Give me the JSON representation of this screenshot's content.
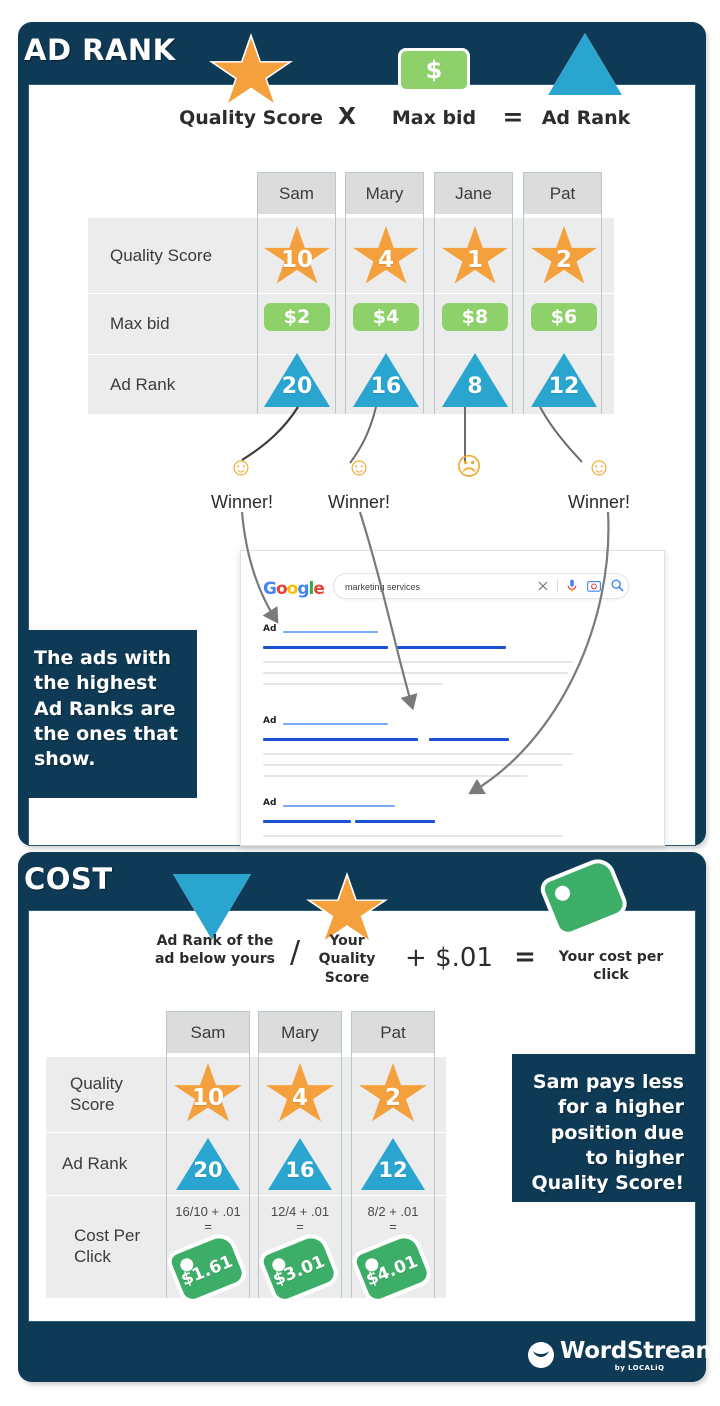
{
  "sections": {
    "ad_rank": {
      "title": "AD RANK",
      "formula": {
        "terms": [
          "Quality Score",
          "Max bid",
          "Ad Rank"
        ],
        "operators": [
          "X",
          "="
        ],
        "icons": [
          "star-icon",
          "money-chip-icon",
          "triangle-up-icon"
        ],
        "money_symbol": "$"
      },
      "table": {
        "columns": [
          "Sam",
          "Mary",
          "Jane",
          "Pat"
        ],
        "rows": [
          {
            "label": "Quality Score",
            "shape": "star",
            "values": [
              "10",
              "4",
              "1",
              "2"
            ]
          },
          {
            "label": "Max bid",
            "shape": "pill",
            "values": [
              "$2",
              "$4",
              "$8",
              "$6"
            ]
          },
          {
            "label": "Ad Rank",
            "shape": "triangle",
            "values": [
              "20",
              "16",
              "8",
              "12"
            ]
          }
        ]
      },
      "outcomes": [
        {
          "emoji": "relieved-face",
          "glyph": "☺",
          "label": "Winner!"
        },
        {
          "emoji": "relieved-face",
          "glyph": "☺",
          "label": "Winner!"
        },
        {
          "emoji": "confused-face",
          "glyph": "☹",
          "label": ""
        },
        {
          "emoji": "relieved-face",
          "glyph": "☺",
          "label": "Winner!"
        }
      ],
      "callout": "The ads with the highest Ad Ranks are the ones that show.",
      "serp": {
        "logo": "Google",
        "query": "marketing services",
        "ad_label": "Ad",
        "ad_count": 3,
        "icons": [
          "close-icon",
          "microphone-icon",
          "camera-icon",
          "search-icon"
        ]
      }
    },
    "cost": {
      "title": "COST",
      "formula": {
        "terms": [
          "Ad Rank of the ad below yours",
          "Your Quality Score",
          "+ $.01",
          "Your cost per click"
        ],
        "operators": [
          "/",
          "="
        ],
        "icons": [
          "triangle-down-icon",
          "star-icon",
          "price-tag-icon"
        ]
      },
      "table": {
        "columns": [
          "Sam",
          "Mary",
          "Pat"
        ],
        "rows": [
          {
            "label": "Quality Score",
            "shape": "star",
            "values": [
              "10",
              "4",
              "2"
            ]
          },
          {
            "label": "Ad Rank",
            "shape": "triangle",
            "values": [
              "20",
              "16",
              "12"
            ]
          },
          {
            "label": "Cost Per Click",
            "shape": "tag",
            "formulas": [
              "16/10 + .01",
              "12/4 + .01",
              "8/2 + .01"
            ],
            "equals": "=",
            "values": [
              "$1.61",
              "$3.01",
              "$4.01"
            ]
          }
        ]
      },
      "callout": "Sam pays less for a higher position due to higher Quality Score!"
    }
  },
  "footer": {
    "brand": "WordStream",
    "tagline": "by LOCALiQ"
  },
  "colors": {
    "navy": "#0e3a55",
    "orange": "#f4a03c",
    "blue": "#29a5cf",
    "light_green": "#8ed06a",
    "green": "#3dae68",
    "row_band": "#ececec",
    "header_cell": "#dcdcdc"
  }
}
